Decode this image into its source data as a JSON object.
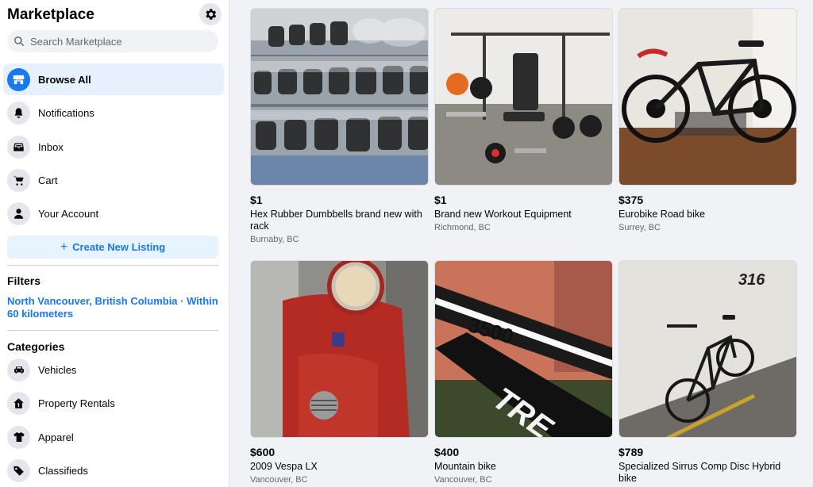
{
  "sidebar": {
    "title": "Marketplace",
    "search_placeholder": "Search Marketplace",
    "nav": [
      {
        "label": "Browse All",
        "icon": "storefront-icon",
        "active": true
      },
      {
        "label": "Notifications",
        "icon": "bell-icon"
      },
      {
        "label": "Inbox",
        "icon": "inbox-icon"
      },
      {
        "label": "Cart",
        "icon": "cart-icon"
      },
      {
        "label": "Your Account",
        "icon": "person-icon"
      }
    ],
    "create_label": "Create New Listing",
    "filters_title": "Filters",
    "filter_location": "North Vancouver, British Columbia · Within 60 kilometers",
    "categories_title": "Categories",
    "categories": [
      {
        "label": "Vehicles",
        "icon": "car-icon"
      },
      {
        "label": "Property Rentals",
        "icon": "house-icon"
      },
      {
        "label": "Apparel",
        "icon": "shirt-icon"
      },
      {
        "label": "Classifieds",
        "icon": "tag-icon"
      }
    ]
  },
  "listings": [
    {
      "price": "$1",
      "title": "Hex Rubber Dumbbells brand new with rack",
      "location": "Burnaby, BC",
      "image": "dumbbells-photo"
    },
    {
      "price": "$1",
      "title": "Brand new Workout Equipment",
      "location": "Richmond, BC",
      "image": "workout-bench-photo"
    },
    {
      "price": "$375",
      "title": "Eurobike Road bike",
      "location": "Surrey, BC",
      "image": "road-bike-photo"
    },
    {
      "price": "$600",
      "title": "2009 Vespa LX",
      "location": "Vancouver, BC",
      "image": "scooter-photo"
    },
    {
      "price": "$400",
      "title": "Mountain bike",
      "location": "Vancouver, BC",
      "image": "bike-frame-photo"
    },
    {
      "price": "$789",
      "title": "Specialized Sirrus Comp Disc Hybrid bike",
      "location": "",
      "image": "hybrid-bike-photo",
      "photo_text": "316"
    }
  ],
  "photo_text": {
    "bike_frame": "3500",
    "bike_brand": "TRE"
  },
  "colors": {
    "accent": "#1877f2",
    "active_bg": "#e7f0fd",
    "page_bg": "#f0f2f5"
  }
}
